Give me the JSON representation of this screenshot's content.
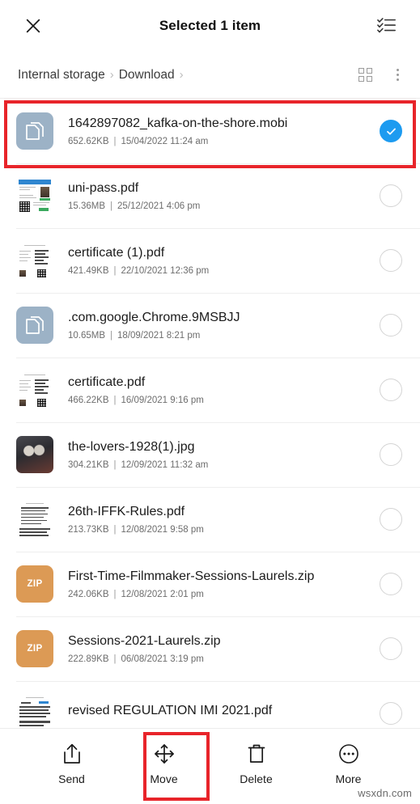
{
  "appbar": {
    "close_icon": "close-x-icon",
    "title": "Selected 1 item",
    "select_all_icon": "select-all-checklist-icon"
  },
  "breadcrumb": {
    "items": [
      "Internal storage",
      "Download"
    ],
    "separator": "›",
    "grid_view_icon": "grid-view-icon",
    "overflow_icon": "kebab-menu-icon"
  },
  "colors": {
    "accent_selected": "#1d9bf0",
    "annotation": "#e8242a",
    "generic_file_icon": "#9cb2c6",
    "zip_icon": "#dc9a55"
  },
  "files": [
    {
      "name": "1642897082_kafka-on-the-shore.mobi",
      "size": "652.62KB",
      "date": "15/04/2022 11:24 am",
      "kind": "generic",
      "selected": true
    },
    {
      "name": "uni-pass.pdf",
      "size": "15.36MB",
      "date": "25/12/2021 4:06 pm",
      "kind": "pdf-id",
      "selected": false
    },
    {
      "name": "certificate (1).pdf",
      "size": "421.49KB",
      "date": "22/10/2021 12:36 pm",
      "kind": "pdf-cert",
      "selected": false
    },
    {
      "name": ".com.google.Chrome.9MSBJJ",
      "size": "10.65MB",
      "date": "18/09/2021 8:21 pm",
      "kind": "generic",
      "selected": false
    },
    {
      "name": "certificate.pdf",
      "size": "466.22KB",
      "date": "16/09/2021 9:16 pm",
      "kind": "pdf-cert",
      "selected": false
    },
    {
      "name": "the-lovers-1928(1).jpg",
      "size": "304.21KB",
      "date": "12/09/2021 11:32 am",
      "kind": "image",
      "selected": false
    },
    {
      "name": "26th-IFFK-Rules.pdf",
      "size": "213.73KB",
      "date": "12/08/2021 9:58 pm",
      "kind": "pdf-text",
      "selected": false
    },
    {
      "name": "First-Time-Filmmaker-Sessions-Laurels.zip",
      "size": "242.06KB",
      "date": "12/08/2021 2:01 pm",
      "kind": "zip",
      "label": "ZIP",
      "selected": false
    },
    {
      "name": "Sessions-2021-Laurels.zip",
      "size": "222.89KB",
      "date": "06/08/2021 3:19 pm",
      "kind": "zip",
      "label": "ZIP",
      "selected": false
    },
    {
      "name": "revised REGULATION IMI 2021.pdf",
      "size": "",
      "date": "",
      "kind": "pdf-text",
      "selected": false
    }
  ],
  "bottom_actions": [
    {
      "label": "Send",
      "icon": "share-upload-icon"
    },
    {
      "label": "Move",
      "icon": "move-arrows-icon"
    },
    {
      "label": "Delete",
      "icon": "trash-icon"
    },
    {
      "label": "More",
      "icon": "more-ellipsis-icon"
    }
  ],
  "watermark": "wsxdn.com"
}
